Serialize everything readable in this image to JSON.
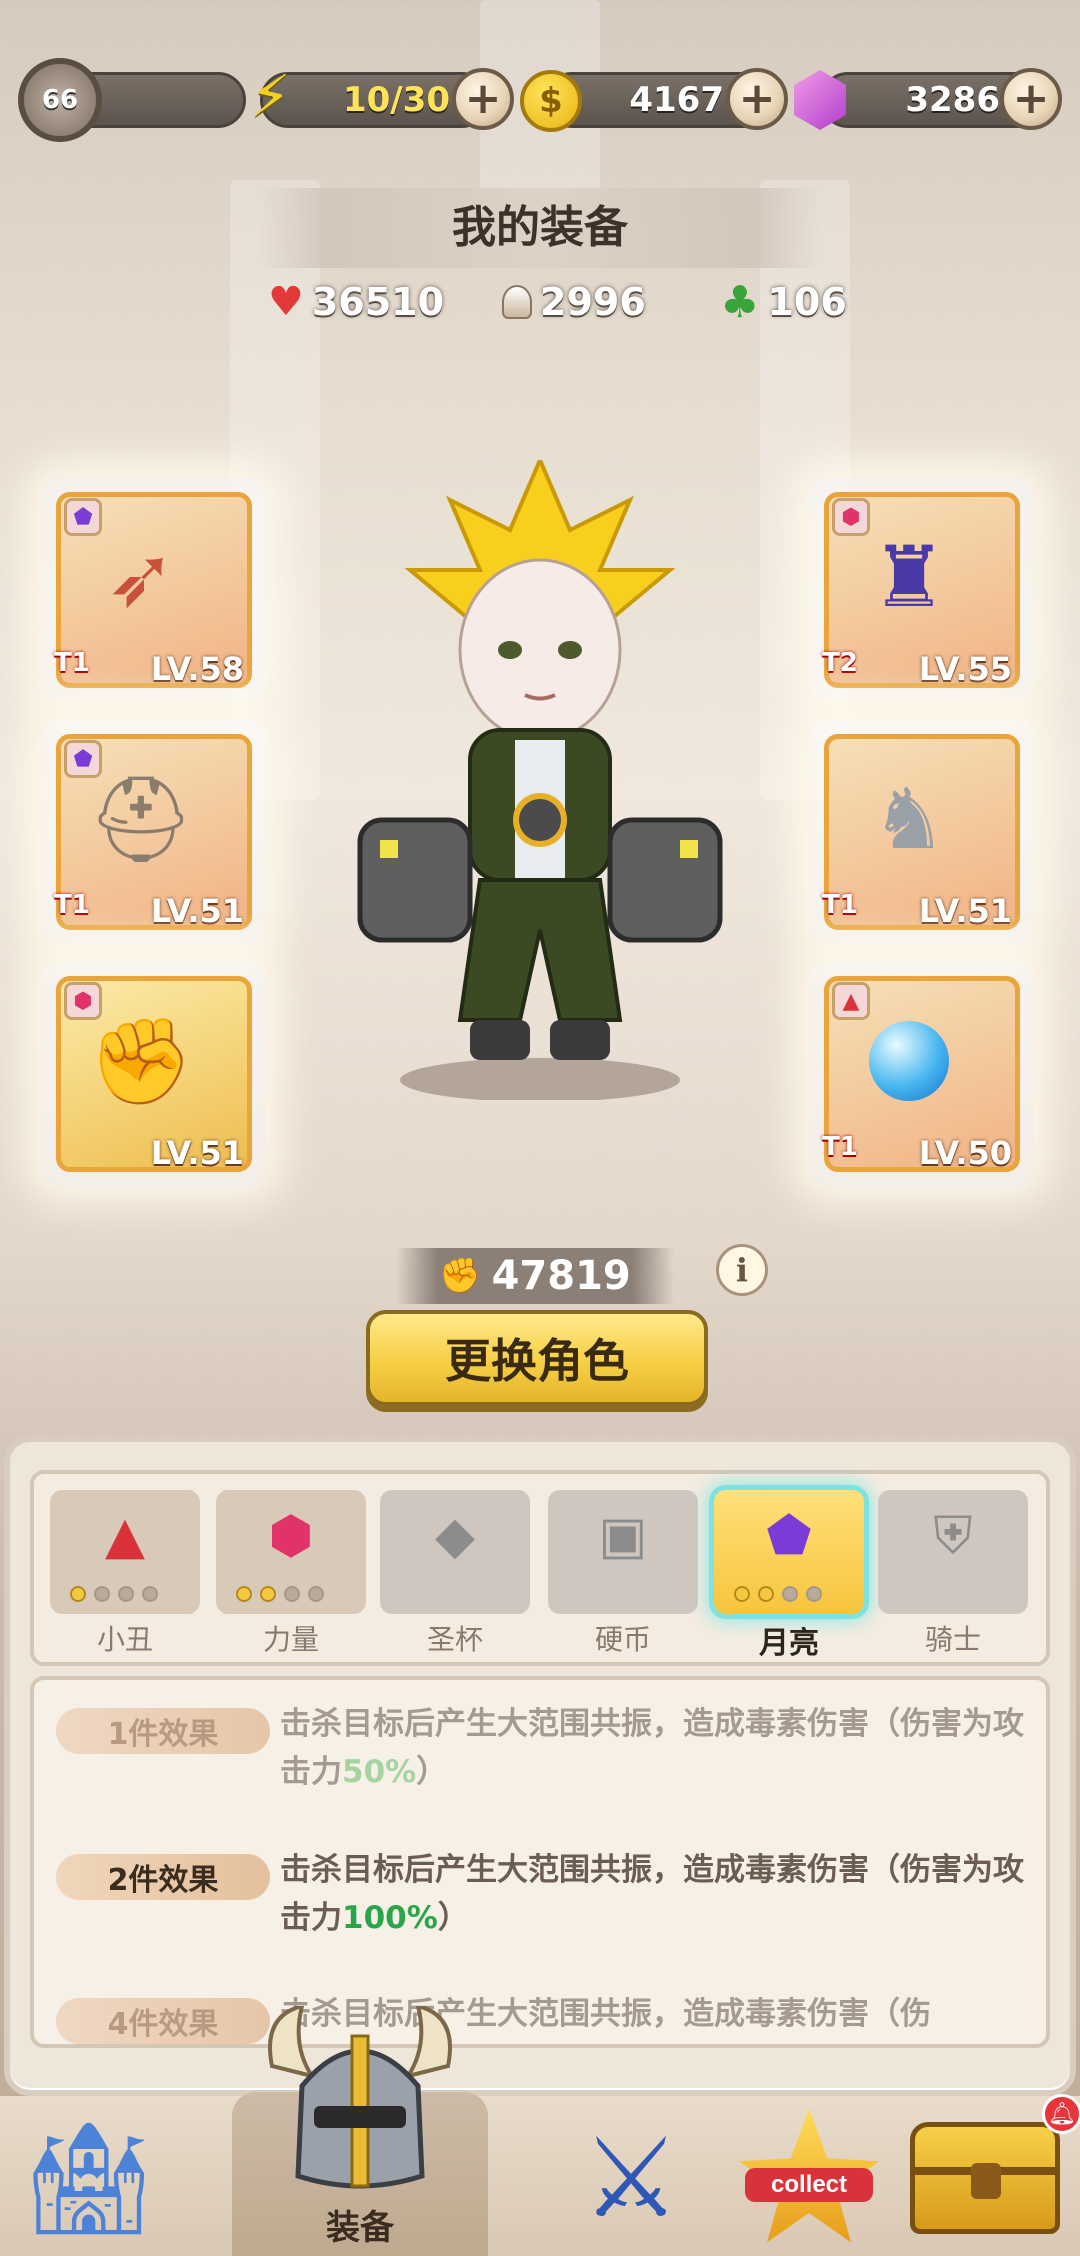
{
  "top_bar": {
    "player_level": "66",
    "energy": "10/30",
    "coins": "4167",
    "gems": "3286"
  },
  "header": {
    "title": "我的装备",
    "stats": {
      "hp": "36510",
      "attack": "2996",
      "luck": "106"
    }
  },
  "equipment": {
    "left": [
      {
        "name": "bow",
        "level": "LV.58",
        "tier": "T1",
        "icon": "bow-icon"
      },
      {
        "name": "helmet",
        "level": "LV.51",
        "tier": "T1",
        "icon": "winged-helmet-icon"
      },
      {
        "name": "gauntlet",
        "level": "LV.51",
        "tier": "",
        "icon": "gauntlet-icon"
      }
    ],
    "right": [
      {
        "name": "cloak",
        "level": "LV.55",
        "tier": "T2",
        "icon": "cloak-icon"
      },
      {
        "name": "boots",
        "level": "LV.51",
        "tier": "T1",
        "icon": "armor-boots-icon"
      },
      {
        "name": "orb",
        "level": "LV.50",
        "tier": "T1",
        "icon": "crystal-orb-icon"
      }
    ]
  },
  "power": "47819",
  "change_button": "更换角色",
  "set_tabs": [
    {
      "label": "小丑",
      "icon": "red-triangle-gem-icon",
      "dots_on": 1,
      "color": "#d9323a"
    },
    {
      "label": "力量",
      "icon": "pink-hexagon-gem-icon",
      "dots_on": 2,
      "color": "#e0336a"
    },
    {
      "label": "圣杯",
      "icon": "gray-diamond-gem-icon",
      "dots_on": 0,
      "color": "#8c8c8c"
    },
    {
      "label": "硬币",
      "icon": "gray-square-gem-icon",
      "dots_on": 0,
      "color": "#8c8c8c"
    },
    {
      "label": "月亮",
      "icon": "purple-pentagon-gem-icon",
      "dots_on": 2,
      "color": "#7b3bd6"
    },
    {
      "label": "骑士",
      "icon": "gray-shield-gem-icon",
      "dots_on": 0,
      "color": "#8c8c8c"
    }
  ],
  "effects": [
    {
      "tag": "1件效果",
      "text_a": "击杀目标后产生大范围共振，造成毒素伤害（伤害为攻击力",
      "highlight": "50%",
      "text_b": "）",
      "active": false
    },
    {
      "tag": "2件效果",
      "text_a": "击杀目标后产生大范围共振，造成毒素伤害（伤害为攻击力",
      "highlight": "100%",
      "text_b": "）",
      "active": true
    },
    {
      "tag": "4件效果",
      "text_a": "击杀目标后产生大范围共振，造成毒素伤害（伤",
      "highlight": "",
      "text_b": "",
      "active": false
    }
  ],
  "nav": {
    "castle": "castle-icon",
    "equip_label": "装备",
    "battle": "sword-shield-icon",
    "collect_label": "collect",
    "chest": "treasure-chest-icon"
  },
  "colors": {
    "accent_gold": "#f6cf45",
    "active_glow": "#7fe2e0",
    "highlight_green": "#2aa64a"
  }
}
